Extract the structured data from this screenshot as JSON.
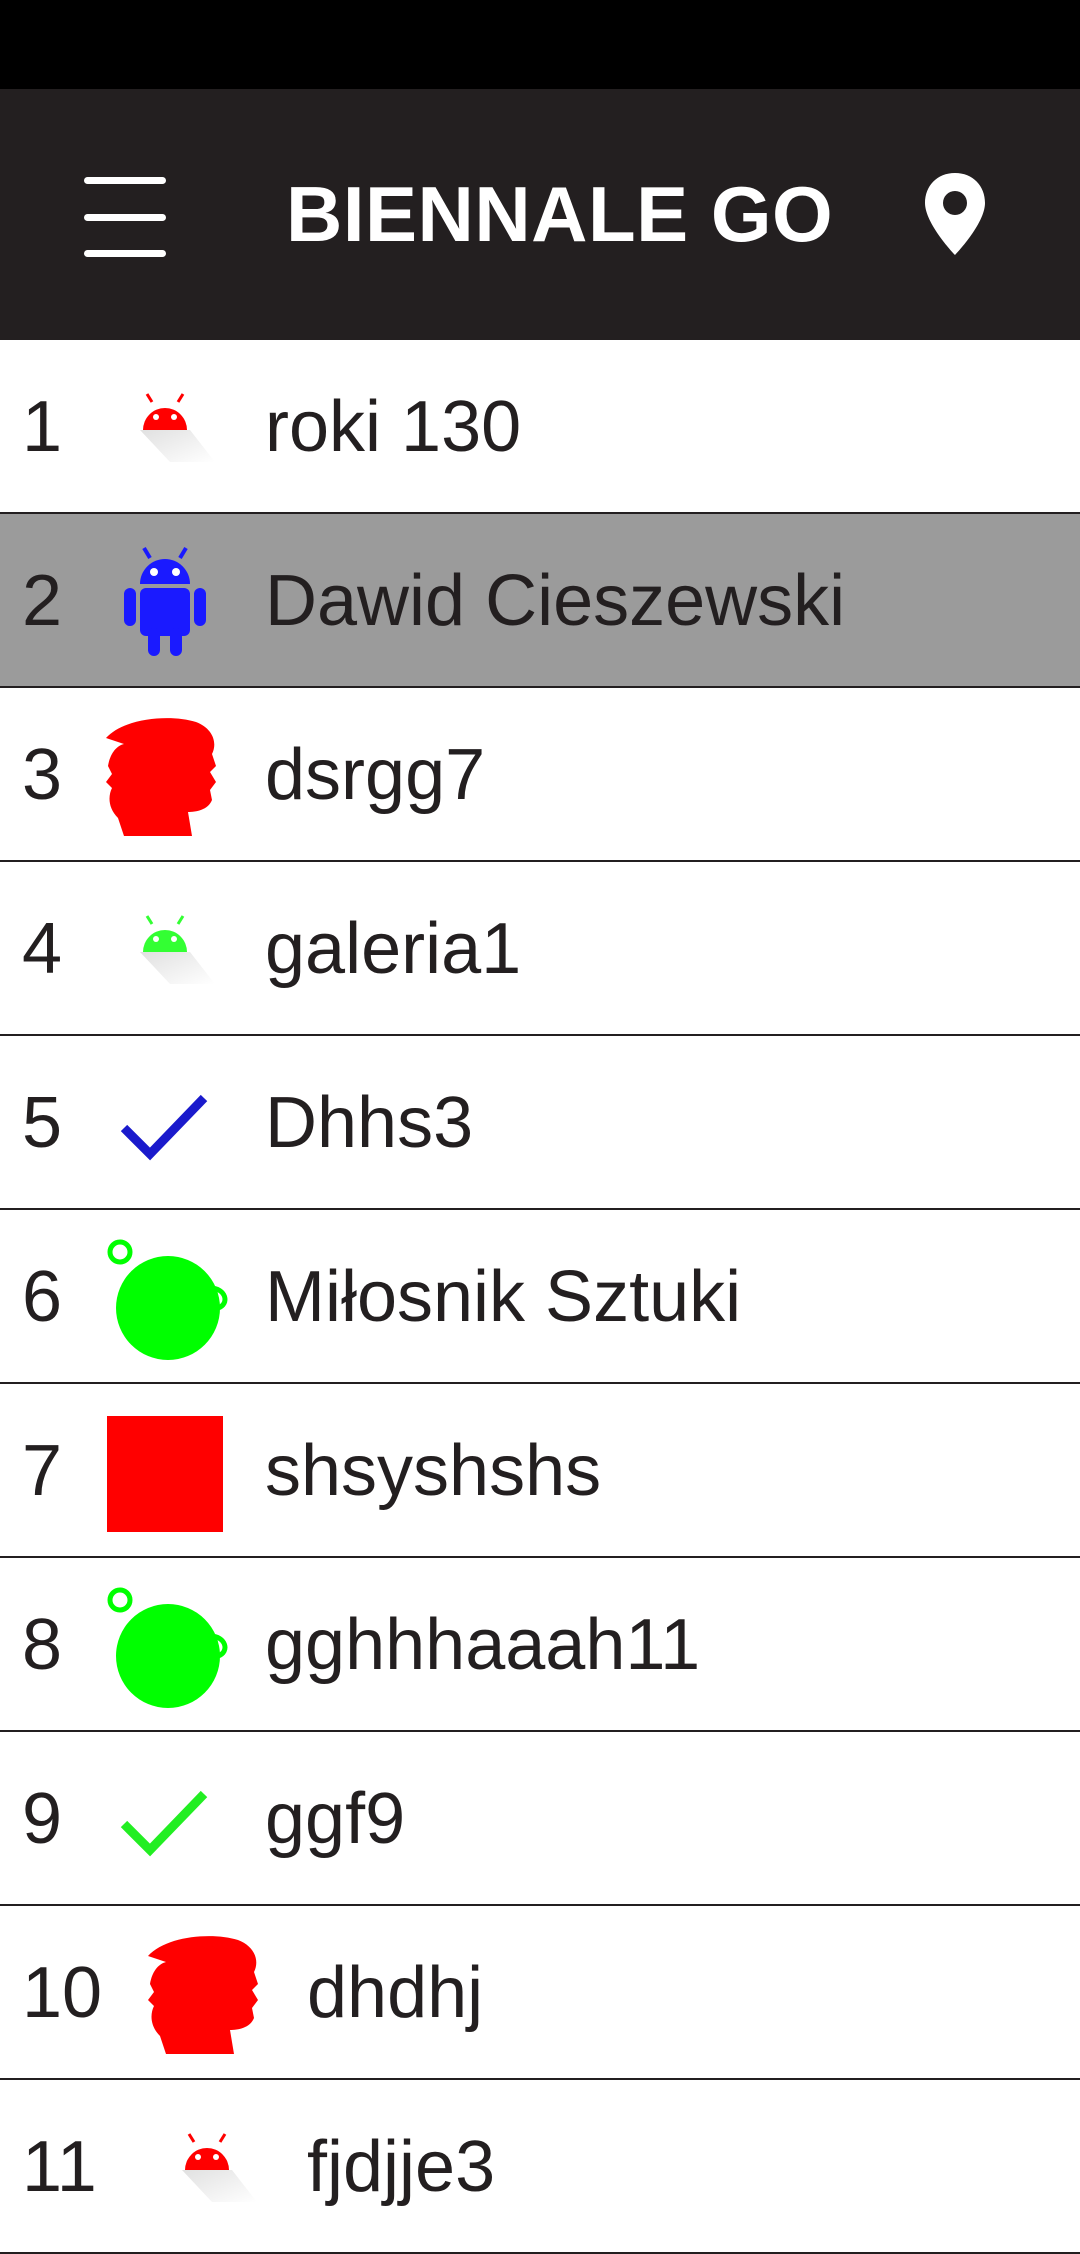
{
  "app": {
    "title": "BIENNALE GO",
    "menu_icon": "hamburger-menu-icon",
    "location_icon": "location-pin-icon"
  },
  "leaderboard": {
    "rows": [
      {
        "rank": "1",
        "name": "roki 130",
        "icon": "android-small-icon",
        "color": "#ff0000"
      },
      {
        "rank": "2",
        "name": "Dawid Cieszewski",
        "icon": "android-icon",
        "color": "#1a1aff",
        "highlight": true
      },
      {
        "rank": "3",
        "name": "dsrgg7",
        "icon": "head-silhouette-icon",
        "color": "#ff0000"
      },
      {
        "rank": "4",
        "name": "galeria1",
        "icon": "android-small-icon",
        "color": "#33ff33"
      },
      {
        "rank": "5",
        "name": "Dhhs3",
        "icon": "checkmark-icon",
        "color": "#1a1acc"
      },
      {
        "rank": "6",
        "name": "Miłosnik Sztuki",
        "icon": "bomb-icon",
        "color": "#00ff00"
      },
      {
        "rank": "7",
        "name": "shsyshshs",
        "icon": "square-icon",
        "color": "#ff0000"
      },
      {
        "rank": "8",
        "name": "gghhhaaah11",
        "icon": "bomb-icon",
        "color": "#00ff00"
      },
      {
        "rank": "9",
        "name": "ggf9",
        "icon": "checkmark-icon",
        "color": "#22ee22"
      },
      {
        "rank": "10",
        "name": "dhdhj",
        "icon": "head-silhouette-icon",
        "color": "#ff0000"
      },
      {
        "rank": "11",
        "name": "fjdjje3",
        "icon": "android-small-icon",
        "color": "#ff0000"
      }
    ]
  }
}
